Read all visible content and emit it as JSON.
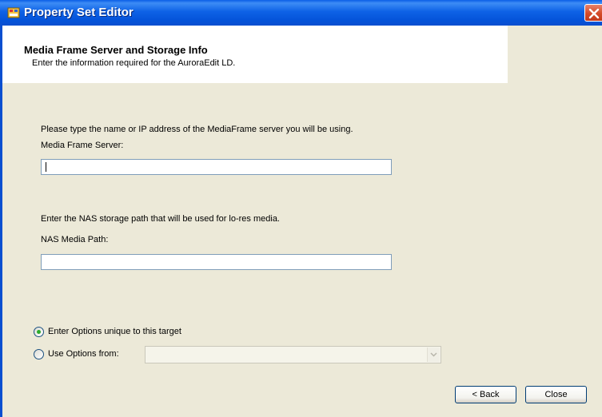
{
  "window": {
    "title": "Property Set Editor",
    "icons": {
      "app": "app-icon",
      "close": "close-icon"
    }
  },
  "header": {
    "title": "Media Frame Server and Storage Info",
    "subtitle": "Enter the information required for the AuroraEdit LD."
  },
  "server": {
    "instruction": "Please type the name or IP address of the MediaFrame server you will be using.",
    "label": "Media Frame Server:",
    "value": ""
  },
  "nas": {
    "instruction": "Enter the NAS storage path that will be used for lo-res media.",
    "label": "NAS Media Path:",
    "value": ""
  },
  "options": {
    "unique_label": "Enter Options unique to this target",
    "unique_selected": true,
    "use_from_label": "Use Options from:",
    "use_from_selected": false,
    "combo_value": ""
  },
  "buttons": {
    "back": "< Back",
    "close": "Close"
  }
}
